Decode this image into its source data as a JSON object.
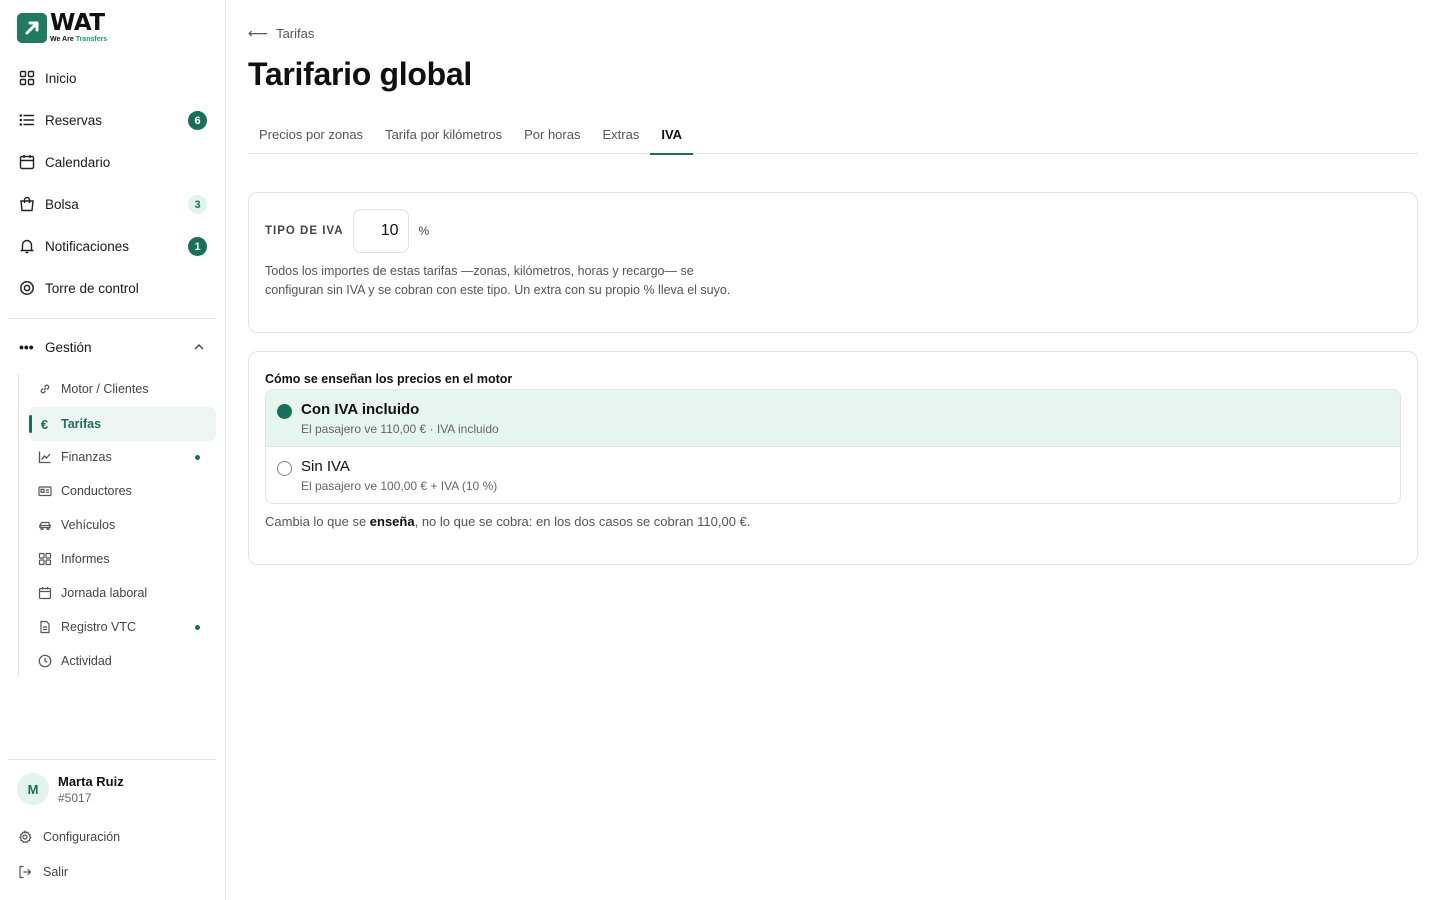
{
  "brand": {
    "word": "WAT",
    "tag_a": "We Are ",
    "tag_b": "Transfers",
    "color": "#1f7a5e"
  },
  "sidebar": {
    "main": [
      {
        "label": "Inicio",
        "icon": "grid-icon"
      },
      {
        "label": "Reservas",
        "icon": "list-icon",
        "badge": "6"
      },
      {
        "label": "Calendario",
        "icon": "calendar-icon"
      },
      {
        "label": "Bolsa",
        "icon": "bag-icon",
        "badge": "3"
      },
      {
        "label": "Notificaciones",
        "icon": "bell-icon",
        "badge": "1"
      },
      {
        "label": "Torre de control",
        "icon": "target-icon"
      }
    ],
    "group": {
      "label": "Gestión",
      "icon": "dots-icon"
    },
    "sub": [
      {
        "label": "Motor / Clientes",
        "icon": "link-icon"
      },
      {
        "label": "Tarifas",
        "icon": "euro-icon",
        "active": true
      },
      {
        "label": "Finanzas",
        "icon": "chart-icon",
        "dot": true
      },
      {
        "label": "Conductores",
        "icon": "id-card-icon"
      },
      {
        "label": "Vehículos",
        "icon": "car-icon"
      },
      {
        "label": "Informes",
        "icon": "grid-icon"
      },
      {
        "label": "Jornada laboral",
        "icon": "calendar-icon"
      },
      {
        "label": "Registro VTC",
        "icon": "document-icon",
        "dot": true
      },
      {
        "label": "Actividad",
        "icon": "clock-icon"
      }
    ],
    "user": {
      "initial": "M",
      "name": "Marta Ruiz",
      "id": "#5017"
    },
    "footer": [
      {
        "label": "Configuración",
        "icon": "gear-icon"
      },
      {
        "label": "Salir",
        "icon": "logout-icon"
      }
    ]
  },
  "main": {
    "back_label": "Tarifas",
    "title": "Tarifario global",
    "tabs": [
      {
        "label": "Precios por zonas"
      },
      {
        "label": "Tarifa por kilómetros"
      },
      {
        "label": "Por horas"
      },
      {
        "label": "Extras"
      },
      {
        "label": "IVA",
        "active": true
      }
    ],
    "iva": {
      "label": "TIPO DE IVA",
      "value": "10",
      "unit": "%",
      "note": "Todos los importes de estas tarifas —zonas, kilómetros, horas y recargo— se configuran sin IVA y se cobran con este tipo. Un extra con su propio % lleva el suyo."
    },
    "display": {
      "title": "Cómo se enseñan los precios en el motor",
      "options": [
        {
          "title": "Con IVA incluido",
          "sub": "El pasajero ve 110,00 € · IVA incluido",
          "selected": true
        },
        {
          "title": "Sin IVA",
          "sub": "El pasajero ve 100,00 € + IVA (10 %)",
          "selected": false
        }
      ],
      "note_a": "Cambia lo que se ",
      "note_bold": "enseña",
      "note_b": ", no lo que se cobra: en los dos casos se cobran 110,00 €."
    }
  },
  "colors": {
    "accent": "#1a6f5b",
    "accent_light": "#e6f5f0",
    "border": "#e3e5e4"
  }
}
